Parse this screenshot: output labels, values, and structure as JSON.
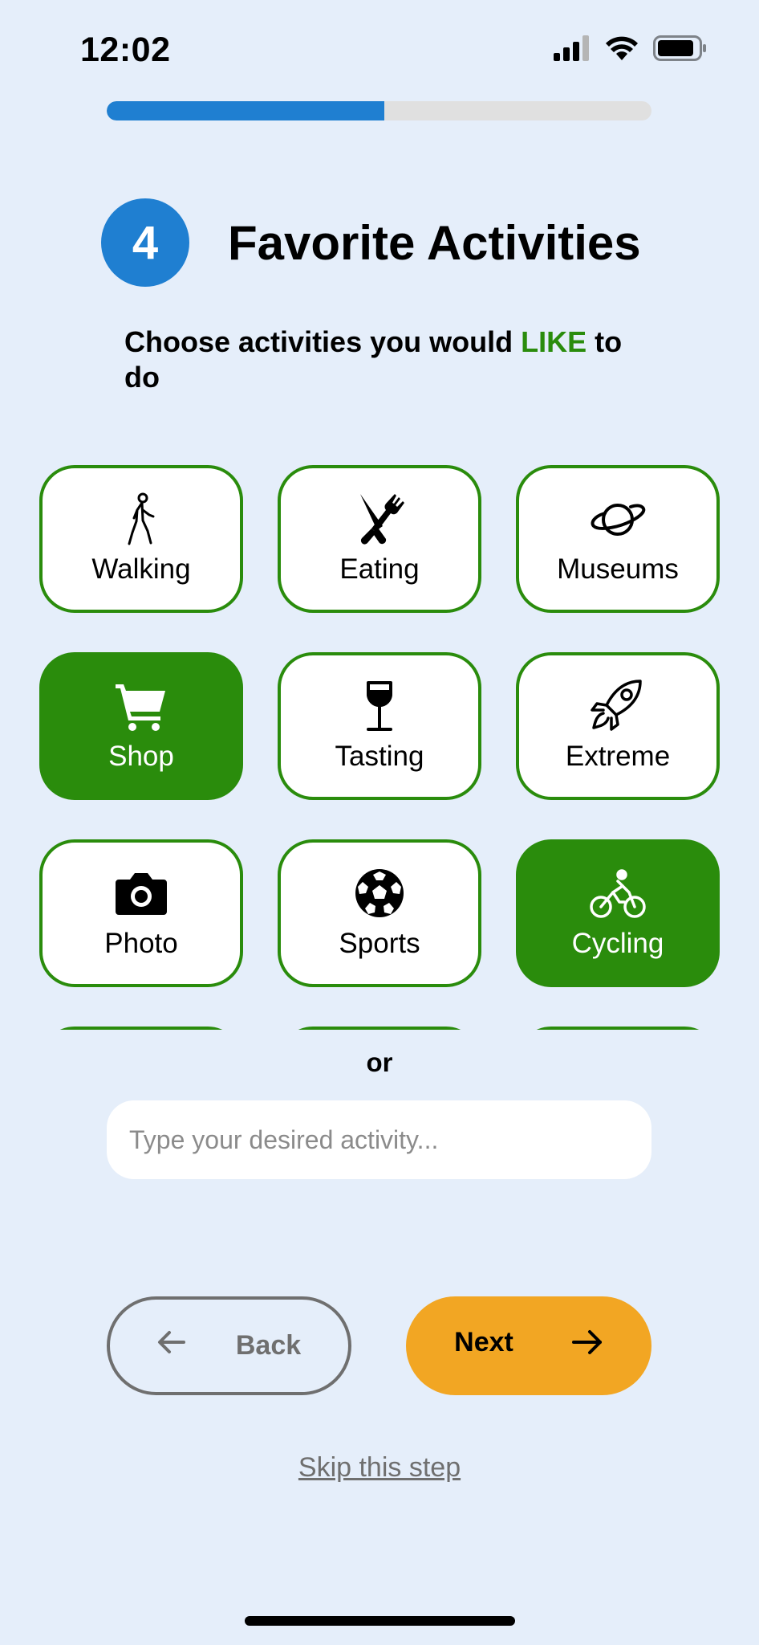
{
  "status_bar": {
    "time": "12:02",
    "icons": [
      "signal-icon",
      "wifi-icon",
      "battery-icon"
    ]
  },
  "progress": {
    "fraction": 0.51,
    "color": "#1f7fd1",
    "track_color": "#e0e0e0"
  },
  "header": {
    "step_number": "4",
    "title": "Favorite Activities"
  },
  "subtitle": {
    "before": "Choose activities you would ",
    "highlight": "LIKE",
    "after": " to do",
    "highlight_color": "#2a8c0c"
  },
  "activities": [
    {
      "label": "Walking",
      "icon": "walking-person-icon",
      "selected": false
    },
    {
      "label": "Eating",
      "icon": "fork-knife-icon",
      "selected": false
    },
    {
      "label": "Museums",
      "icon": "planet-icon",
      "selected": false
    },
    {
      "label": "Shop",
      "icon": "shopping-cart-icon",
      "selected": true
    },
    {
      "label": "Tasting",
      "icon": "wine-glass-icon",
      "selected": false
    },
    {
      "label": "Extreme",
      "icon": "rocket-icon",
      "selected": false
    },
    {
      "label": "Photo",
      "icon": "camera-icon",
      "selected": false
    },
    {
      "label": "Sports",
      "icon": "soccer-ball-icon",
      "selected": false
    },
    {
      "label": "Cycling",
      "icon": "cyclist-icon",
      "selected": true
    },
    {
      "label": "",
      "icon": "",
      "selected": false
    },
    {
      "label": "",
      "icon": "",
      "selected": false
    },
    {
      "label": "",
      "icon": "",
      "selected": false
    }
  ],
  "divider_text": "or",
  "custom_activity": {
    "placeholder": "Type your desired activity...",
    "value": ""
  },
  "buttons": {
    "back_label": "Back",
    "next_label": "Next",
    "skip_label": "Skip this step"
  },
  "colors": {
    "background": "#e5eefa",
    "accent_green": "#2a8c0c",
    "next_orange": "#f2a623",
    "step_blue": "#1f7fd1"
  }
}
